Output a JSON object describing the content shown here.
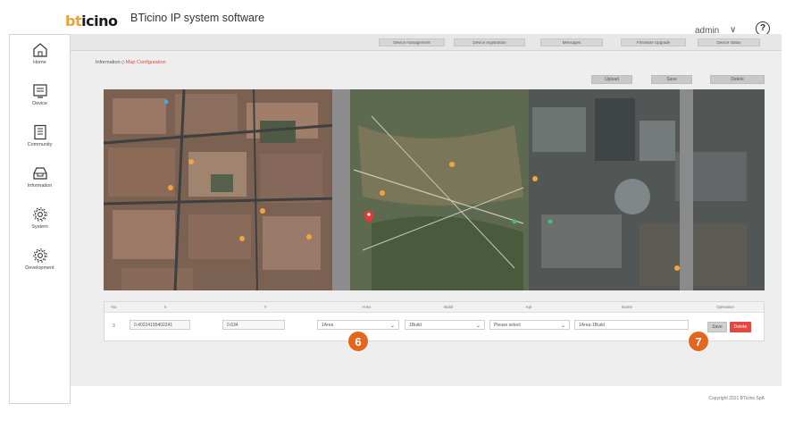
{
  "header": {
    "logo_text_a": "bt",
    "logo_text_b": "icino",
    "app_title": "BTicino IP system software",
    "user": "admin",
    "user_caret": "∨",
    "help": "?"
  },
  "sidebar": {
    "items": [
      {
        "label": "Home",
        "icon": "home-icon"
      },
      {
        "label": "Device",
        "icon": "device-icon"
      },
      {
        "label": "Community",
        "icon": "community-icon"
      },
      {
        "label": "Information",
        "icon": "information-icon"
      },
      {
        "label": "System",
        "icon": "system-gear-icon"
      },
      {
        "label": "Development",
        "icon": "development-gear-icon"
      }
    ]
  },
  "tabs": [
    {
      "label": "Device management"
    },
    {
      "label": "Device registration"
    },
    {
      "label": "Messages"
    },
    {
      "label": "Firmware Upgrade"
    },
    {
      "label": "Device status"
    }
  ],
  "breadcrumb": {
    "parent": "Information",
    "separator": "◇",
    "current": "Map Configuration"
  },
  "actions": {
    "upload": "Upload",
    "save": "Save",
    "delete": "Delete"
  },
  "table": {
    "headers": [
      "No.",
      "X",
      "Y",
      "Area",
      "Build",
      "Apt",
      "Name",
      "Operation"
    ],
    "row": {
      "no": "3",
      "x": "0.40224195402241",
      "y": "0.634",
      "area": "1Area",
      "build": "1Build",
      "apt": "Please select",
      "name": "1Area-1Build",
      "save": "Save",
      "delete": "Delete"
    }
  },
  "callouts": [
    "6",
    "7"
  ],
  "footer": {
    "copyright": "Copyright 2021 BTicino SpA"
  },
  "colors": {
    "accent_red": "#e6463f",
    "callout_orange": "#e3661e",
    "logo_orange": "#e8a23a"
  }
}
